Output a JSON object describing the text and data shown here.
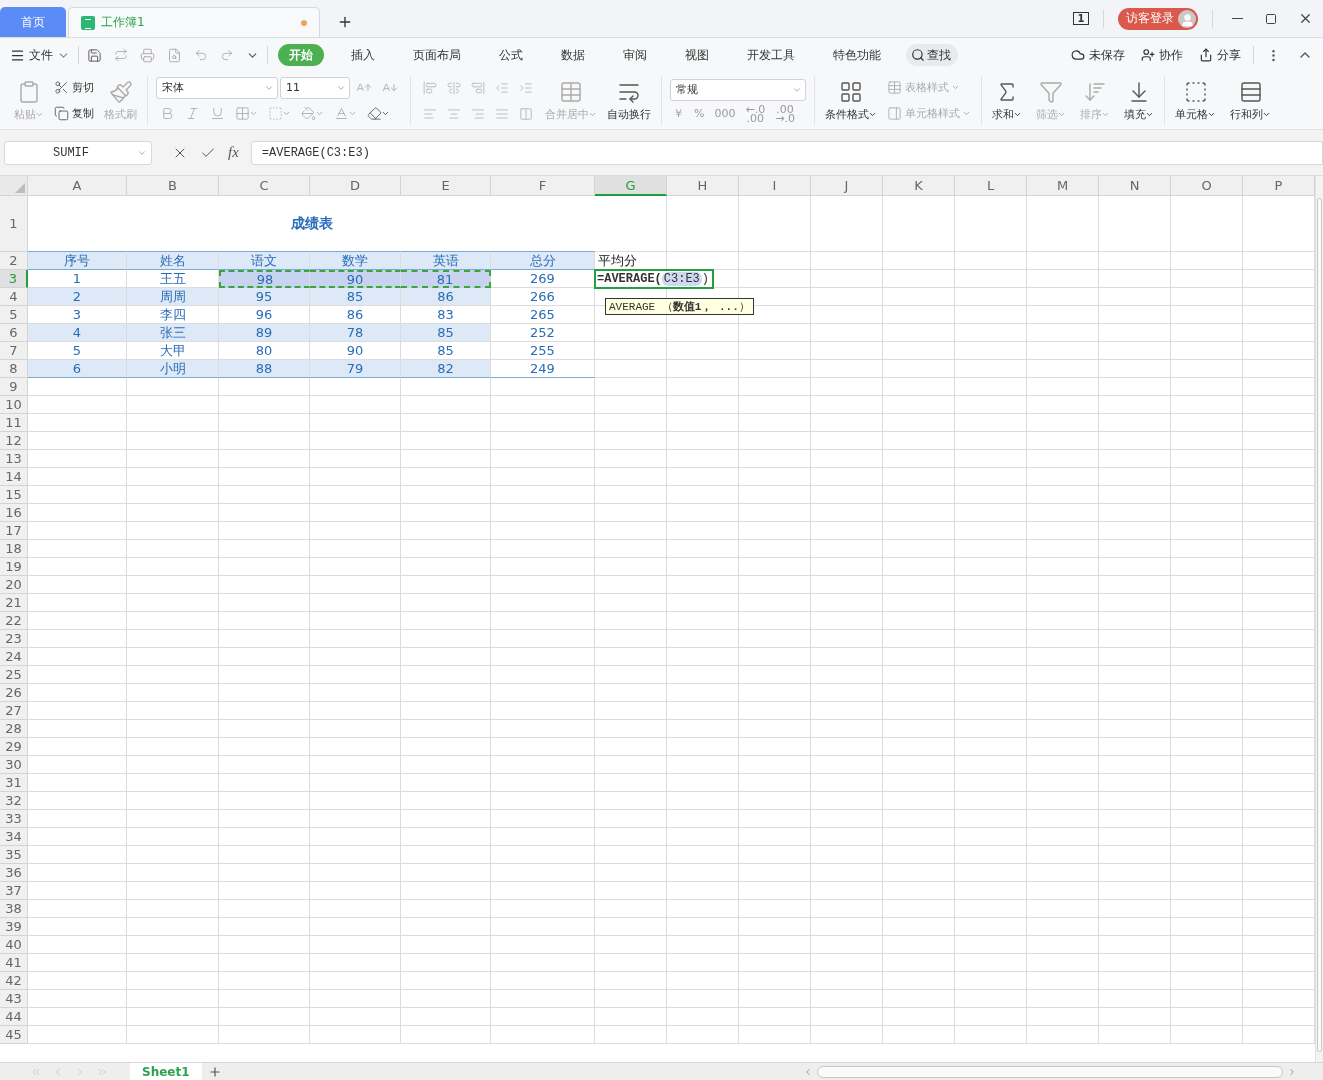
{
  "title_bar": {
    "tabs": [
      {
        "label": "首页",
        "kind": "home",
        "selected": false
      },
      {
        "label": "工作簿1",
        "kind": "doc",
        "selected": true,
        "unsaved": true
      }
    ],
    "page_count": "1",
    "login": "访客登录"
  },
  "menu_bar": {
    "file": "文件",
    "tabs": [
      {
        "label": "开始",
        "selected": true
      },
      {
        "label": "插入",
        "selected": false
      },
      {
        "label": "页面布局",
        "selected": false
      },
      {
        "label": "公式",
        "selected": false
      },
      {
        "label": "数据",
        "selected": false
      },
      {
        "label": "审阅",
        "selected": false
      },
      {
        "label": "视图",
        "selected": false
      },
      {
        "label": "开发工具",
        "selected": false
      },
      {
        "label": "特色功能",
        "selected": false
      }
    ],
    "search": "查找",
    "actions": [
      "未保存",
      "协作",
      "分享"
    ]
  },
  "ribbon": {
    "clipboard": [
      {
        "label": "粘贴",
        "disabled": true,
        "menu": true
      },
      {
        "label": "剪切",
        "disabled": false,
        "menu": false
      },
      {
        "label": "复制",
        "disabled": false,
        "menu": false
      },
      {
        "label": "格式刷",
        "disabled": true,
        "menu": false
      }
    ],
    "font": {
      "name": "宋体",
      "size": "11"
    },
    "alignment": [
      {
        "label": "合并居中",
        "disabled": true,
        "menu": true
      },
      {
        "label": "自动换行",
        "disabled": false,
        "menu": false
      }
    ],
    "number": {
      "format": "常规",
      "symbols": [
        "￥",
        "%",
        "000"
      ],
      "decimal_buttons": [
        [
          "←.0",
          ".00"
        ],
        [
          ".00",
          "→.0"
        ]
      ]
    },
    "styles": [
      {
        "label": "条件格式",
        "disabled": false,
        "menu": true
      },
      {
        "label": "表格样式",
        "disabled": true,
        "menu": true
      },
      {
        "label": "单元格样式",
        "disabled": true,
        "menu": true
      }
    ],
    "editing": [
      {
        "label": "求和",
        "disabled": false,
        "menu": true
      },
      {
        "label": "筛选",
        "disabled": true,
        "menu": true
      },
      {
        "label": "排序",
        "disabled": true,
        "menu": true
      },
      {
        "label": "填充",
        "disabled": false,
        "menu": true
      }
    ],
    "cells": [
      {
        "label": "单元格",
        "disabled": false,
        "menu": true
      },
      {
        "label": "行和列",
        "disabled": false,
        "menu": true
      }
    ]
  },
  "formula_bar": {
    "name_box": "SUMIF",
    "fx": "fx",
    "formula": "=AVERAGE(C3:E3)"
  },
  "sheet": {
    "columns": [
      {
        "label": "A",
        "selected": false
      },
      {
        "label": "B",
        "selected": false
      },
      {
        "label": "C",
        "selected": false
      },
      {
        "label": "D",
        "selected": false
      },
      {
        "label": "E",
        "selected": false
      },
      {
        "label": "F",
        "selected": false
      },
      {
        "label": "G",
        "selected": true
      },
      {
        "label": "H",
        "selected": false
      },
      {
        "label": "I",
        "selected": false
      },
      {
        "label": "J",
        "selected": false
      },
      {
        "label": "K",
        "selected": false
      },
      {
        "label": "L",
        "selected": false
      },
      {
        "label": "M",
        "selected": false
      },
      {
        "label": "N",
        "selected": false
      },
      {
        "label": "O",
        "selected": false
      },
      {
        "label": "P",
        "selected": false
      }
    ],
    "rows": [
      {
        "label": "1",
        "selected": false,
        "kind": "title",
        "cells": [
          "成绩表"
        ]
      },
      {
        "label": "2",
        "selected": false,
        "kind": "header",
        "cells": [
          "序号",
          "姓名",
          "语文",
          "数学",
          "英语",
          "总分",
          "平均分"
        ]
      },
      {
        "label": "3",
        "selected": true,
        "kind": "data",
        "banded": false,
        "cells": [
          {
            "text": "1",
            "referenced": false
          },
          {
            "text": "王五",
            "referenced": false
          },
          {
            "text": "98",
            "referenced": true
          },
          {
            "text": "90",
            "referenced": true
          },
          {
            "text": "81",
            "referenced": true
          },
          {
            "text": "269",
            "referenced": false
          }
        ],
        "editor": {
          "prefix": "=AVERAGE(",
          "ref": "C3:E3",
          "suffix": ")",
          "hint": "AVERAGE （**数值1， ...**）"
        }
      },
      {
        "label": "4",
        "selected": false,
        "kind": "data",
        "banded": true,
        "cells": [
          {
            "text": "2",
            "referenced": false
          },
          {
            "text": "周周",
            "referenced": false
          },
          {
            "text": "95",
            "referenced": false
          },
          {
            "text": "85",
            "referenced": false
          },
          {
            "text": "86",
            "referenced": false
          },
          {
            "text": "266",
            "referenced": false
          }
        ]
      },
      {
        "label": "5",
        "selected": false,
        "kind": "data",
        "banded": false,
        "cells": [
          {
            "text": "3",
            "referenced": false
          },
          {
            "text": "李四",
            "referenced": false
          },
          {
            "text": "96",
            "referenced": false
          },
          {
            "text": "86",
            "referenced": false
          },
          {
            "text": "83",
            "referenced": false
          },
          {
            "text": "265",
            "referenced": false
          }
        ]
      },
      {
        "label": "6",
        "selected": false,
        "kind": "data",
        "banded": true,
        "cells": [
          {
            "text": "4",
            "referenced": false
          },
          {
            "text": "张三",
            "referenced": false
          },
          {
            "text": "89",
            "referenced": false
          },
          {
            "text": "78",
            "referenced": false
          },
          {
            "text": "85",
            "referenced": false
          },
          {
            "text": "252",
            "referenced": false
          }
        ]
      },
      {
        "label": "7",
        "selected": false,
        "kind": "data",
        "banded": false,
        "cells": [
          {
            "text": "5",
            "referenced": false
          },
          {
            "text": "大甲",
            "referenced": false
          },
          {
            "text": "80",
            "referenced": false
          },
          {
            "text": "90",
            "referenced": false
          },
          {
            "text": "85",
            "referenced": false
          },
          {
            "text": "255",
            "referenced": false
          }
        ]
      },
      {
        "label": "8",
        "selected": false,
        "kind": "data",
        "banded": true,
        "cells": [
          {
            "text": "6",
            "referenced": false
          },
          {
            "text": "小明",
            "referenced": false
          },
          {
            "text": "88",
            "referenced": false
          },
          {
            "text": "79",
            "referenced": false
          },
          {
            "text": "82",
            "referenced": false
          },
          {
            "text": "249",
            "referenced": false
          }
        ]
      },
      {
        "label": "9",
        "selected": false,
        "kind": "blank"
      },
      {
        "label": "10",
        "selected": false,
        "kind": "blank"
      },
      {
        "label": "11",
        "selected": false,
        "kind": "blank"
      },
      {
        "label": "12",
        "selected": false,
        "kind": "blank"
      },
      {
        "label": "13",
        "selected": false,
        "kind": "blank"
      },
      {
        "label": "14",
        "selected": false,
        "kind": "blank"
      },
      {
        "label": "15",
        "selected": false,
        "kind": "blank"
      },
      {
        "label": "16",
        "selected": false,
        "kind": "blank"
      },
      {
        "label": "17",
        "selected": false,
        "kind": "blank"
      },
      {
        "label": "18",
        "selected": false,
        "kind": "blank"
      },
      {
        "label": "19",
        "selected": false,
        "kind": "blank"
      },
      {
        "label": "20",
        "selected": false,
        "kind": "blank"
      },
      {
        "label": "21",
        "selected": false,
        "kind": "blank"
      },
      {
        "label": "22",
        "selected": false,
        "kind": "blank"
      },
      {
        "label": "23",
        "selected": false,
        "kind": "blank"
      },
      {
        "label": "24",
        "selected": false,
        "kind": "blank"
      },
      {
        "label": "25",
        "selected": false,
        "kind": "blank"
      },
      {
        "label": "26",
        "selected": false,
        "kind": "blank"
      },
      {
        "label": "27",
        "selected": false,
        "kind": "blank"
      },
      {
        "label": "28",
        "selected": false,
        "kind": "blank"
      },
      {
        "label": "29",
        "selected": false,
        "kind": "blank"
      },
      {
        "label": "30",
        "selected": false,
        "kind": "blank"
      },
      {
        "label": "31",
        "selected": false,
        "kind": "blank"
      },
      {
        "label": "32",
        "selected": false,
        "kind": "blank"
      },
      {
        "label": "33",
        "selected": false,
        "kind": "blank"
      },
      {
        "label": "34",
        "selected": false,
        "kind": "blank"
      },
      {
        "label": "35",
        "selected": false,
        "kind": "blank"
      },
      {
        "label": "36",
        "selected": false,
        "kind": "blank"
      },
      {
        "label": "37",
        "selected": false,
        "kind": "blank"
      },
      {
        "label": "38",
        "selected": false,
        "kind": "blank"
      },
      {
        "label": "39",
        "selected": false,
        "kind": "blank"
      },
      {
        "label": "40",
        "selected": false,
        "kind": "blank"
      },
      {
        "label": "41",
        "selected": false,
        "kind": "blank"
      },
      {
        "label": "42",
        "selected": false,
        "kind": "blank"
      },
      {
        "label": "43",
        "selected": false,
        "kind": "blank"
      },
      {
        "label": "44",
        "selected": false,
        "kind": "blank"
      },
      {
        "label": "45",
        "selected": false,
        "kind": "blank"
      }
    ]
  },
  "sheet_tabs": [
    {
      "label": "Sheet1",
      "selected": true
    }
  ]
}
